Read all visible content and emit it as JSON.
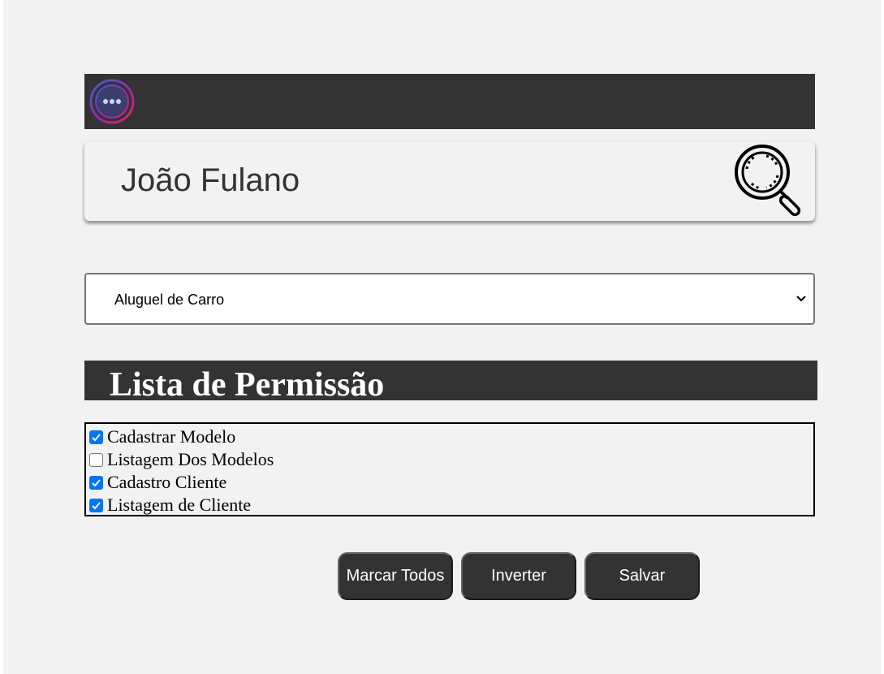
{
  "header": {
    "logo_icon": "chat-dots-icon",
    "logo_gradient": [
      "#3b5bdb",
      "#9c27b0",
      "#e91e63"
    ]
  },
  "search": {
    "value": "João Fulano",
    "icon": "magnifier-icon"
  },
  "select": {
    "selected": "Aluguel de Carro"
  },
  "permissions": {
    "title": "Lista de Permissão",
    "items": [
      {
        "label": "Cadastrar Modelo",
        "checked": true
      },
      {
        "label": "Listagem Dos Modelos",
        "checked": false
      },
      {
        "label": "Cadastro Cliente",
        "checked": true
      },
      {
        "label": "Listagem de Cliente",
        "checked": true
      }
    ]
  },
  "actions": {
    "mark_all": "Marcar Todos",
    "invert": "Inverter",
    "save": "Salvar"
  },
  "colors": {
    "dark": "#333333",
    "background": "#f2f2f2",
    "checkbox_accent": "#0075ff"
  }
}
